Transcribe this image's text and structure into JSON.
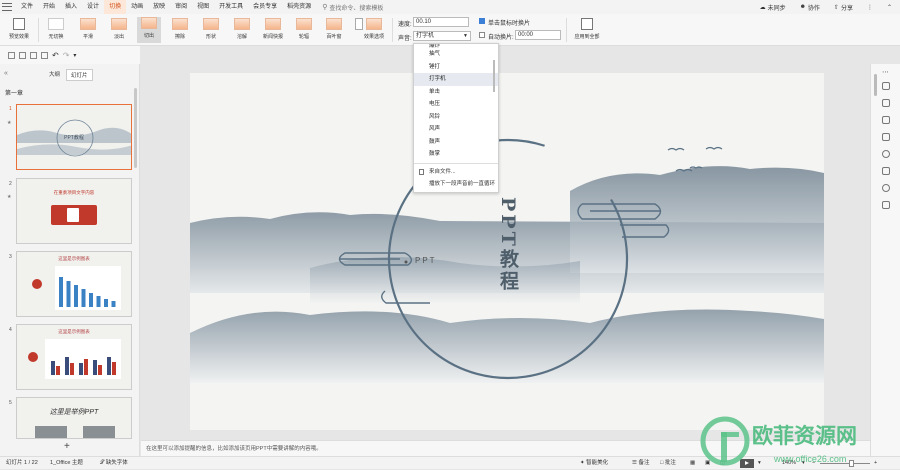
{
  "menubar": {
    "items": [
      "文件",
      "开始",
      "插入",
      "设计",
      "切换",
      "动画",
      "放映",
      "审阅",
      "视图",
      "开发工具",
      "会员专享",
      "稻壳资源"
    ],
    "active_index": 4,
    "search_placeholder": "查找命令、搜索模板",
    "unsynced": "未同步",
    "collab": "协作",
    "share": "分享"
  },
  "ribbon": {
    "preview_label": "预览效果",
    "effects": [
      "无切换",
      "平滑",
      "淡出",
      "切出",
      "擦除",
      "形状",
      "溶解",
      "新闻快报",
      "轮辐",
      "百叶窗",
      "随机"
    ],
    "selected_effect": "切出",
    "effect_options_label": "效果选项",
    "speed_label": "速度:",
    "speed_value": "00.10",
    "sound_label": "声音:",
    "sound_value": "打字机",
    "on_click_label": "单击鼠标时换片",
    "on_click_checked": true,
    "auto_label": "自动换片:",
    "auto_value": "00:00",
    "apply_all_label": "应用到全部"
  },
  "sound_dropdown": {
    "items": [
      "爆炸",
      "抽气",
      "锤打",
      "打字机",
      "单击",
      "电压",
      "风铃",
      "风声",
      "鼓声",
      "鼓掌"
    ],
    "highlighted": "打字机",
    "actions": [
      "来自文件...",
      "播放下一段声音前一直循环"
    ]
  },
  "sidepanel": {
    "tabs": [
      "大纲",
      "幻灯片"
    ],
    "active_tab": "幻灯片",
    "section_title": "第一章",
    "thumbnails": [
      {
        "num": "1",
        "title": "PPT教程"
      },
      {
        "num": "2",
        "title": "在重奏项目文字内容"
      },
      {
        "num": "3",
        "title": "这里是示例图表"
      },
      {
        "num": "4",
        "title": "这里是示例图表"
      },
      {
        "num": "5",
        "title": "这里是举例PPT"
      }
    ]
  },
  "slide": {
    "title": "PPT教程",
    "subtitle": "PPT"
  },
  "notes_placeholder": "在这里可以添加提醒的信息，比如添加该页用PPT中需要讲解的内容哦。",
  "statusbar": {
    "slide_counter": "幻灯片 1 / 22",
    "theme": "1_Office 主题",
    "missing_font": "缺失字体",
    "smart_beautify": "智能美化",
    "notes": "备注",
    "comments": "批注",
    "zoom": "140%"
  },
  "watermark": {
    "text": "欧菲资源网",
    "url": "www.office26.com"
  },
  "colors": {
    "accent": "#d2541d",
    "slide_ink": "#5a7184"
  }
}
